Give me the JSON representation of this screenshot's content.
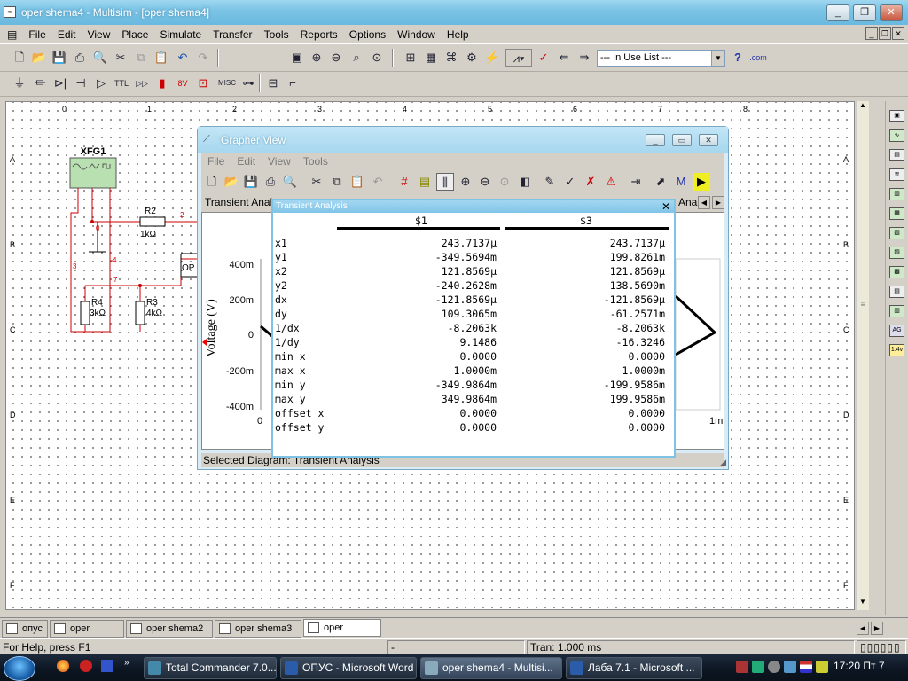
{
  "window": {
    "title": "oper shema4 - Multisim - [oper shema4]"
  },
  "menu": [
    "File",
    "Edit",
    "View",
    "Place",
    "Simulate",
    "Transfer",
    "Tools",
    "Reports",
    "Options",
    "Window",
    "Help"
  ],
  "toolbar": {
    "in_use_list": "--- In Use List ---",
    "com_label": ".com"
  },
  "parts_toolbar": {
    "misc": "MISC"
  },
  "rulers": {
    "top": [
      "0",
      "1",
      "2",
      "3",
      "4",
      "5",
      "6",
      "7",
      "8"
    ],
    "side": [
      "A",
      "B",
      "C",
      "D",
      "E",
      "F"
    ]
  },
  "schematic": {
    "xfg": "XFG1",
    "r2": {
      "name": "R2",
      "value": "1kΩ"
    },
    "r3": {
      "name": "R3",
      "value": "4kΩ"
    },
    "r4": {
      "name": "R4",
      "value": "3kΩ"
    },
    "opamp": "OP",
    "nets": {
      "n0": "0",
      "n2": "2",
      "n3": "3",
      "n4": "4",
      "n7": "7"
    }
  },
  "grapher": {
    "title": "Grapher View",
    "menu": [
      "File",
      "Edit",
      "View",
      "Tools"
    ],
    "tab_left": "Transient Analy",
    "tab_right": "Ana",
    "status": "Selected Diagram: Transient Analysis",
    "plot": {
      "ylabel": "Voltage (V)",
      "yticks": [
        "400m",
        "200m",
        "0",
        "-200m",
        "-400m"
      ],
      "x_left": "0",
      "x_right": "1m"
    }
  },
  "cursor_dialog": {
    "title": "Transient Analysis",
    "col1": "$1",
    "col3": "$3",
    "rows": [
      {
        "k": "x1",
        "a": "243.7137µ",
        "b": "243.7137µ"
      },
      {
        "k": "y1",
        "a": "-349.5694m",
        "b": "199.8261m"
      },
      {
        "k": "x2",
        "a": "121.8569µ",
        "b": "121.8569µ"
      },
      {
        "k": "y2",
        "a": "-240.2628m",
        "b": "138.5690m"
      },
      {
        "k": "dx",
        "a": "-121.8569µ",
        "b": "-121.8569µ"
      },
      {
        "k": "dy",
        "a": "109.3065m",
        "b": "-61.2571m"
      },
      {
        "k": "1/dx",
        "a": "-8.2063k",
        "b": "-8.2063k"
      },
      {
        "k": "1/dy",
        "a": "9.1486",
        "b": "-16.3246"
      },
      {
        "k": "min x",
        "a": "0.0000",
        "b": "0.0000"
      },
      {
        "k": "max x",
        "a": "1.0000m",
        "b": "1.0000m"
      },
      {
        "k": "min y",
        "a": "-349.9864m",
        "b": "-199.9586m"
      },
      {
        "k": "max y",
        "a": "349.9864m",
        "b": "199.9586m"
      },
      {
        "k": "offset x",
        "a": "0.0000",
        "b": "0.0000"
      },
      {
        "k": "offset y",
        "a": "0.0000",
        "b": "0.0000"
      }
    ]
  },
  "tabs": [
    "опус",
    "oper shema",
    "oper shema2 *",
    "oper shema3 *",
    "oper shema4"
  ],
  "status": {
    "help": "For Help, press F1",
    "middle": "-",
    "tran": "Tran: 1.000 ms"
  },
  "taskbar": {
    "items": [
      "Total Commander 7.0....",
      "ОПУС - Microsoft Word",
      "oper shema4 - Multisi...",
      "Лаба 7.1 - Microsoft ..."
    ],
    "clock": "17:20 Пт 7"
  }
}
